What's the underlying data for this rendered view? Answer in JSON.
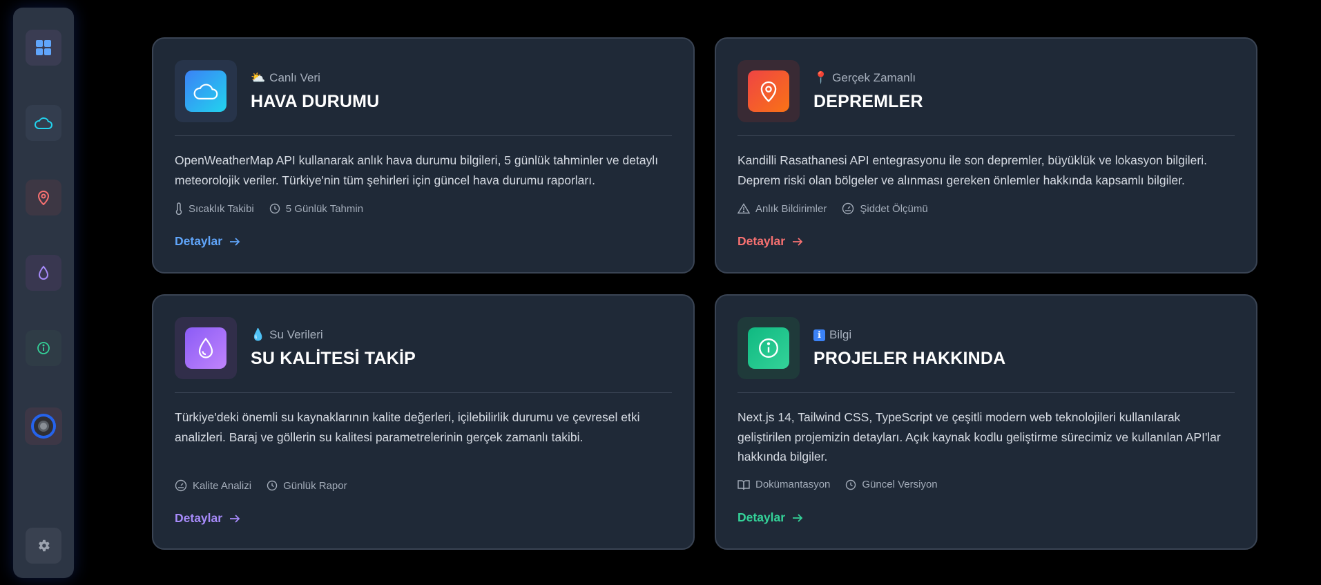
{
  "sidebar": {
    "items": [
      {
        "icon": "dashboard-icon",
        "color": "#60a5fa"
      },
      {
        "icon": "cloud-icon",
        "color": "#22d3ee"
      },
      {
        "icon": "map-pin-icon",
        "color": "#f87171"
      },
      {
        "icon": "droplet-icon",
        "color": "#a78bfa"
      },
      {
        "icon": "info-icon",
        "color": "#34d399"
      },
      {
        "icon": "avatar",
        "color": "#2563eb"
      },
      {
        "icon": "gear-icon",
        "color": "#9ca3af"
      }
    ]
  },
  "cards": [
    {
      "eyebrow_emoji": "⛅",
      "eyebrow": "Canlı Veri",
      "title": "HAVA DURUMU",
      "description": "OpenWeatherMap API kullanarak anlık hava durumu bilgileri, 5 günlük tahminler ve detaylı meteorolojik veriler. Türkiye'nin tüm şehirleri için güncel hava durumu raporları.",
      "tags": [
        {
          "icon": "thermometer-icon",
          "label": "Sıcaklık Takibi"
        },
        {
          "icon": "clock-icon",
          "label": "5 Günlük Tahmin"
        }
      ],
      "link": "Detaylar",
      "accent": "#60a5fa"
    },
    {
      "eyebrow_emoji": "📍",
      "eyebrow": "Gerçek Zamanlı",
      "title": "DEPREMLER",
      "description": "Kandilli Rasathanesi API entegrasyonu ile son depremler, büyüklük ve lokasyon bilgileri. Deprem riski olan bölgeler ve alınması gereken önlemler hakkında kapsamlı bilgiler.",
      "tags": [
        {
          "icon": "warning-icon",
          "label": "Anlık Bildirimler"
        },
        {
          "icon": "gauge-icon",
          "label": "Şiddet Ölçümü"
        }
      ],
      "link": "Detaylar",
      "accent": "#f87171"
    },
    {
      "eyebrow_emoji": "💧",
      "eyebrow": "Su Verileri",
      "title": "SU KALİTESİ TAKİP",
      "description": "Türkiye'deki önemli su kaynaklarının kalite değerleri, içilebilirlik durumu ve çevresel etki analizleri. Baraj ve göllerin su kalitesi parametrelerinin gerçek zamanlı takibi.",
      "tags": [
        {
          "icon": "gauge-icon",
          "label": "Kalite Analizi"
        },
        {
          "icon": "clock-icon",
          "label": "Günlük Rapor"
        }
      ],
      "link": "Detaylar",
      "accent": "#a78bfa"
    },
    {
      "eyebrow_emoji": "ℹ",
      "eyebrow": "Bilgi",
      "title": "PROJELER HAKKINDA",
      "description": "Next.js 14, Tailwind CSS, TypeScript ve çeşitli modern web teknolojileri kullanılarak geliştirilen projemizin detayları. Açık kaynak kodlu geliştirme sürecimiz ve kullanılan API'lar hakkında bilgiler.",
      "tags": [
        {
          "icon": "book-icon",
          "label": "Dokümantasyon"
        },
        {
          "icon": "clock-icon",
          "label": "Güncel Versiyon"
        }
      ],
      "link": "Detaylar",
      "accent": "#34d399"
    }
  ]
}
